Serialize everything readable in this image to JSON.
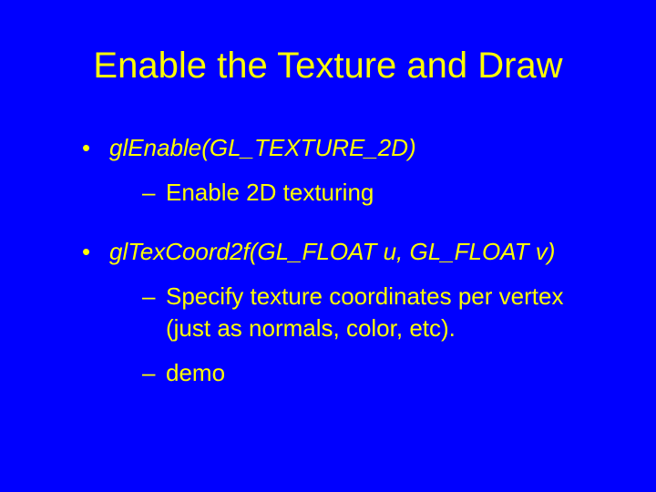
{
  "slide": {
    "title": "Enable the Texture and Draw",
    "bullets": [
      {
        "text_html": "<span class=\"italic\">glEnable(GL_TEXTURE_2D)</span>",
        "sub": [
          "Enable 2D texturing"
        ]
      },
      {
        "text_html": "<span class=\"italic\">glTexCoord2f(GL_FLOAT u, GL_FLOAT v)</span>",
        "sub": [
          "Specify texture coordinates per vertex (just as normals, color, etc).",
          "demo"
        ]
      }
    ]
  },
  "colors": {
    "background": "#0000ff",
    "text": "#ffff00"
  }
}
